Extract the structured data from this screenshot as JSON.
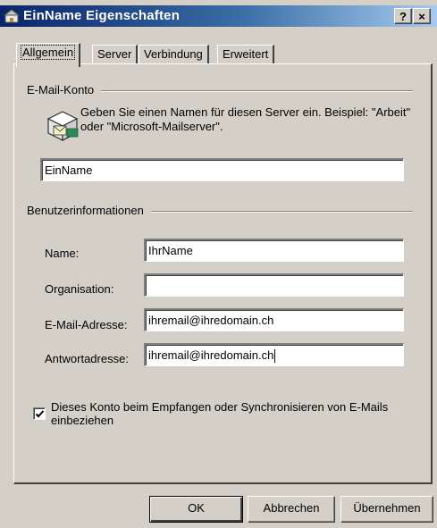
{
  "window": {
    "title": "EinName Eigenschaften",
    "help_button": "?",
    "close_button": "×"
  },
  "tabs": [
    {
      "label": "Allgemein",
      "active": true
    },
    {
      "label": "Server",
      "active": false
    },
    {
      "label": "Verbindung",
      "active": false
    },
    {
      "label": "Erweitert",
      "active": false
    }
  ],
  "email_account": {
    "group_label": "E-Mail-Konto",
    "description": "Geben Sie einen Namen für diesen Server ein. Beispiel: \"Arbeit\" oder \"Microsoft-Mailserver\".",
    "account_name_value": "EinName"
  },
  "user_info": {
    "group_label": "Benutzerinformationen",
    "fields": [
      {
        "label": "Name:",
        "value": "IhrName"
      },
      {
        "label": "Organisation:",
        "value": ""
      },
      {
        "label": "E-Mail-Adresse:",
        "value": "ihremail@ihredomain.ch"
      },
      {
        "label": "Antwortadresse:",
        "value": "ihremail@ihredomain.ch"
      }
    ]
  },
  "include_account": {
    "checked": true,
    "label": "Dieses Konto beim Empfangen oder Synchronisieren von E-Mails einbeziehen"
  },
  "buttons": {
    "ok": "OK",
    "cancel": "Abbrechen",
    "apply": "Übernehmen"
  },
  "colors": {
    "title_bar_start": "#0a246a",
    "title_bar_end": "#a6caf0",
    "face": "#d4d0c8"
  }
}
